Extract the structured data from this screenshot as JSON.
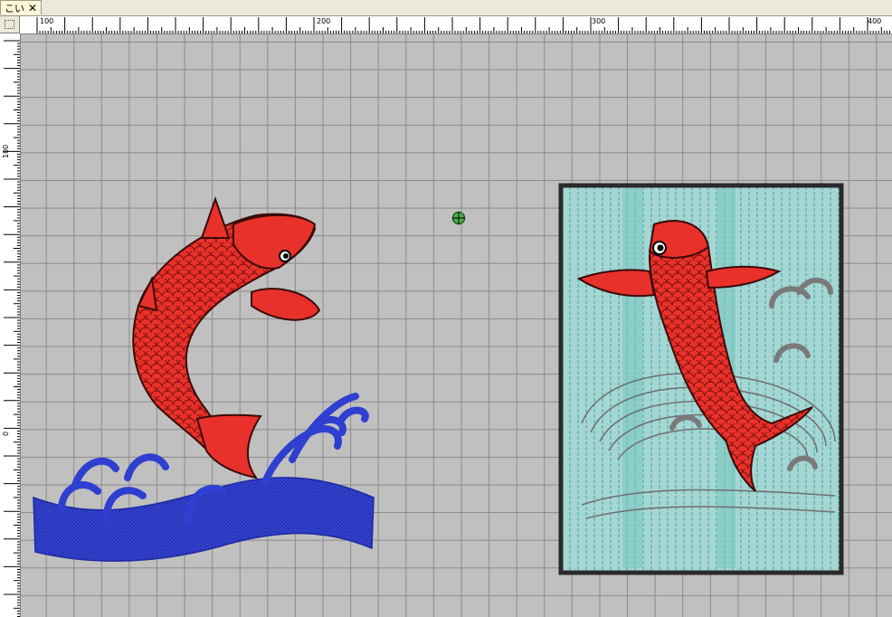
{
  "tab": {
    "label": "こい",
    "close_glyph": "✕"
  },
  "ruler": {
    "top_labels": [
      "100",
      "200",
      "300",
      "400"
    ],
    "left_labels": [
      "100",
      "0"
    ]
  },
  "colors": {
    "canvas": "#c0c0c0",
    "grid": "#8a8a8a",
    "koi_red": "#e8312a",
    "wave_blue": "#2f3fd0",
    "hoop_fill": "#9fd3d0",
    "hoop_border": "#2a2a2a",
    "swirl_gray": "#7a7a7a"
  },
  "canvas": {
    "designs": [
      "leaping-koi-with-waves",
      "framed-koi-waterfall"
    ],
    "cursor_icon": "crosshair-target-icon"
  }
}
